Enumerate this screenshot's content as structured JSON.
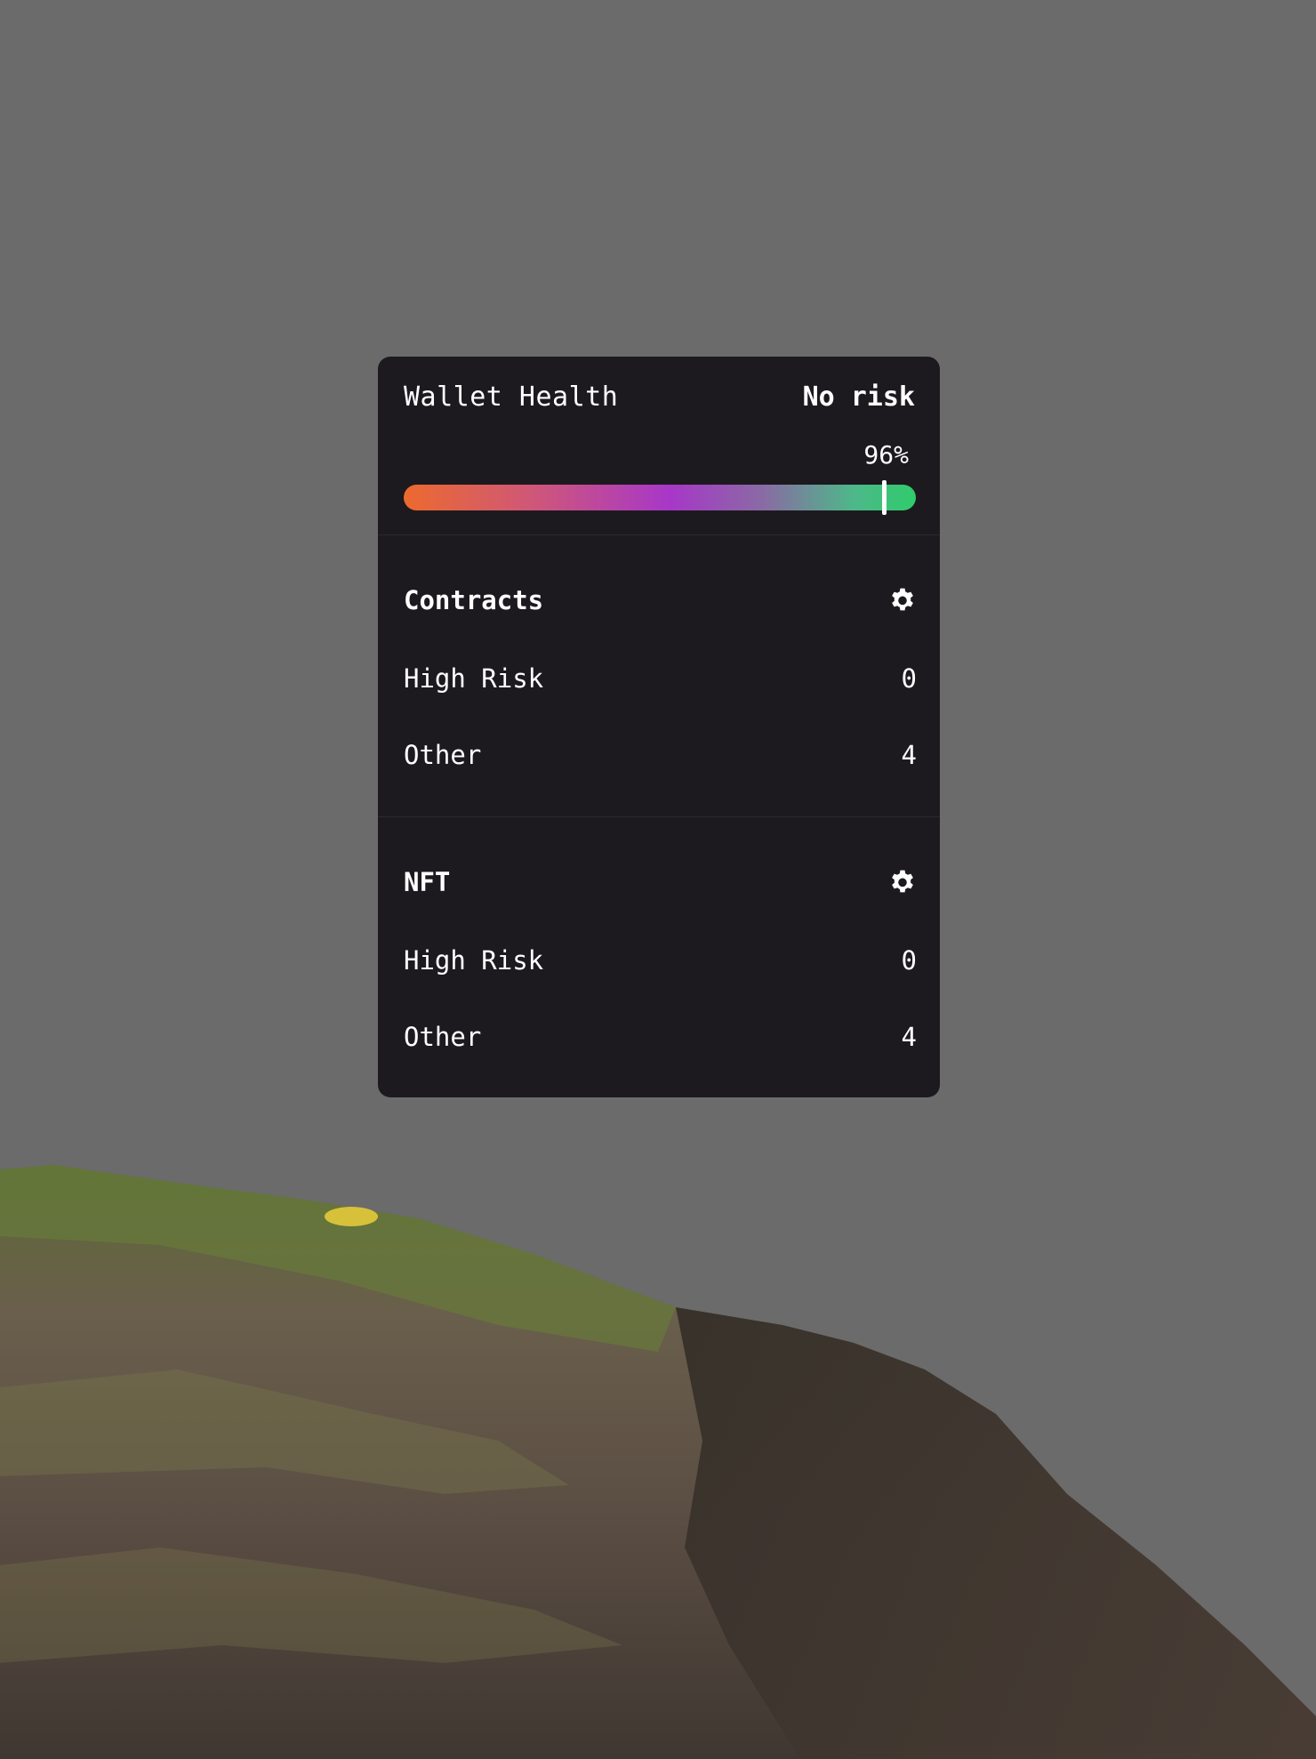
{
  "wallet_health": {
    "title": "Wallet Health",
    "status": "No risk",
    "percent_label": "96%",
    "percent_value": 0.94,
    "colors": {
      "start": "#ec6a2e",
      "middle": "#a737c8",
      "end": "#2fcc6c"
    }
  },
  "sections": [
    {
      "title": "Contracts",
      "icon": "gear-icon",
      "rows": [
        {
          "label": "High Risk",
          "value": "0"
        },
        {
          "label": "Other",
          "value": "4"
        }
      ]
    },
    {
      "title": "NFT",
      "icon": "gear-icon",
      "rows": [
        {
          "label": "High Risk",
          "value": "0"
        },
        {
          "label": "Other",
          "value": "4"
        }
      ]
    }
  ]
}
